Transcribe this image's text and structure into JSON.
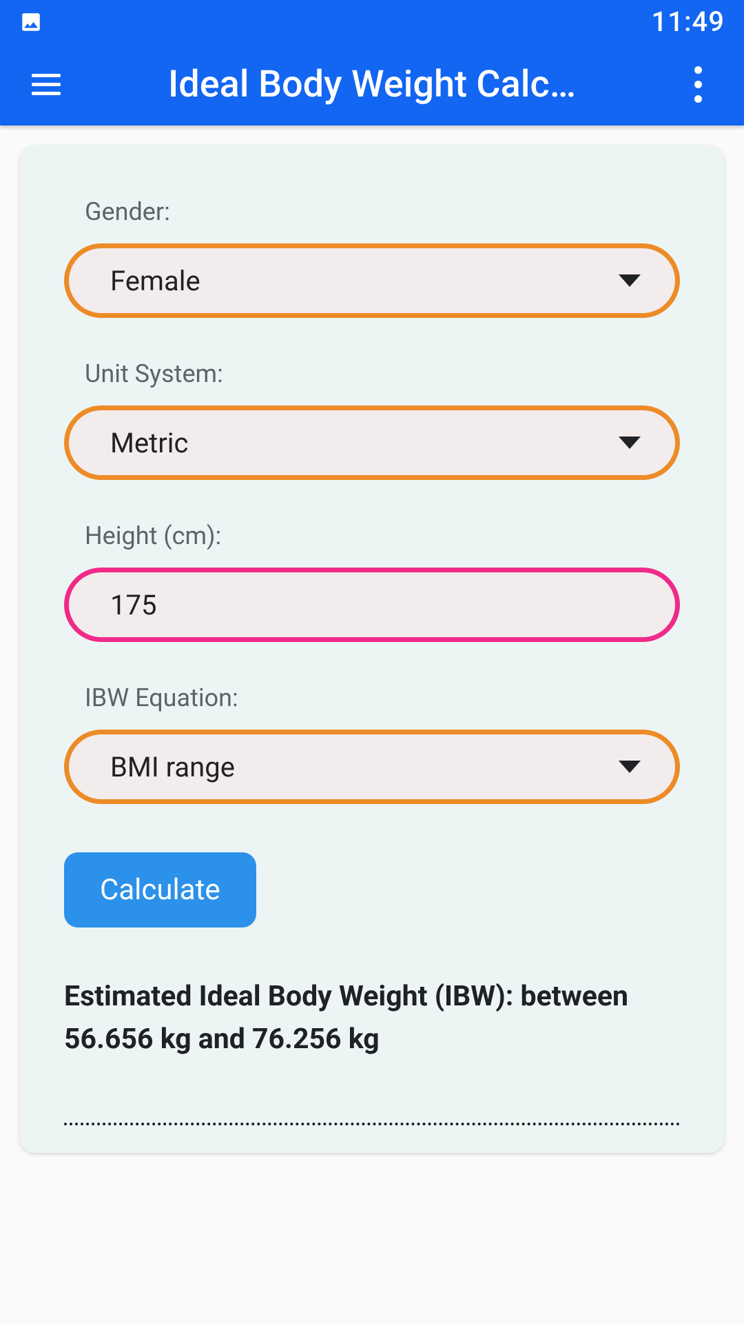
{
  "status_bar": {
    "time": "11:49"
  },
  "app_bar": {
    "title": "Ideal Body Weight Calc…"
  },
  "form": {
    "gender": {
      "label": "Gender:",
      "value": "Female"
    },
    "unit_system": {
      "label": "Unit System:",
      "value": "Metric"
    },
    "height": {
      "label": "Height (cm):",
      "value": "175"
    },
    "equation": {
      "label": "IBW Equation:",
      "value": "BMI range"
    },
    "calculate_button": "Calculate"
  },
  "result": {
    "text": "Estimated Ideal Body Weight (IBW): between 56.656 kg and 76.256 kg"
  }
}
